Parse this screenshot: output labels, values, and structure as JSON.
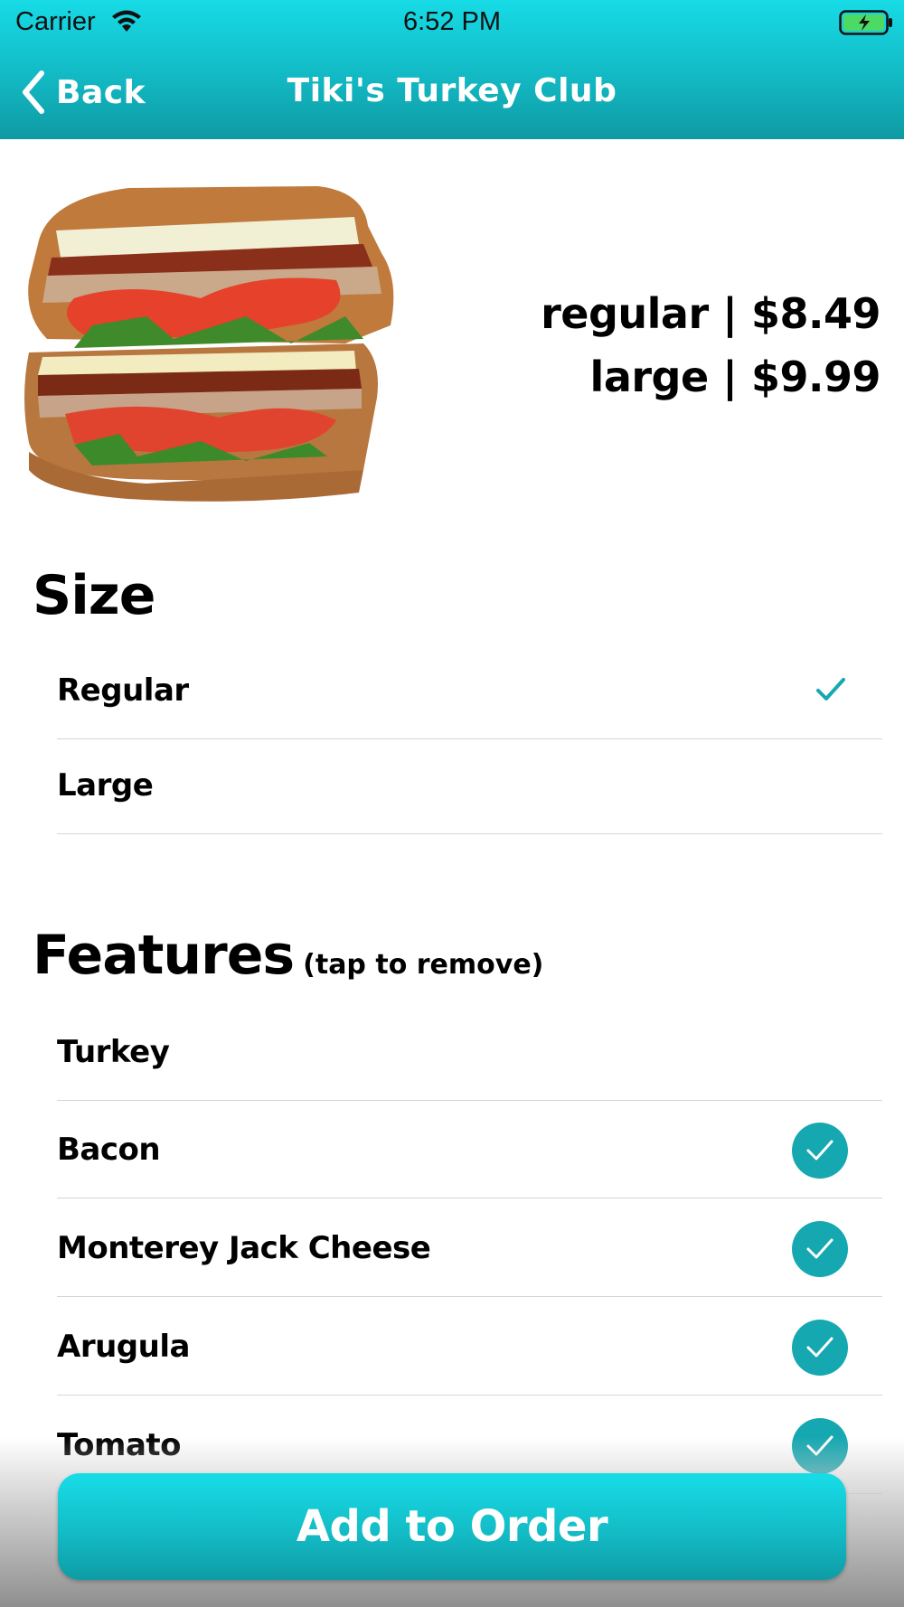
{
  "status_bar": {
    "carrier": "Carrier",
    "time": "6:52 PM",
    "wifi_icon": "wifi-icon",
    "battery_icon": "battery-charging-icon"
  },
  "nav": {
    "back_label": "Back",
    "title": "Tiki's Turkey Club"
  },
  "product": {
    "image_icon": "sandwich-image",
    "prices": [
      "regular | $8.49",
      "large | $9.99"
    ]
  },
  "size_section": {
    "title": "Size",
    "options": [
      {
        "label": "Regular",
        "selected": true
      },
      {
        "label": "Large",
        "selected": false
      }
    ]
  },
  "features_section": {
    "title": "Features",
    "note": "(tap to remove)",
    "items": [
      {
        "label": "Turkey",
        "checked": false
      },
      {
        "label": "Bacon",
        "checked": true
      },
      {
        "label": "Monterey Jack Cheese",
        "checked": true
      },
      {
        "label": "Arugula",
        "checked": true
      },
      {
        "label": "Tomato",
        "checked": true
      }
    ]
  },
  "footer": {
    "add_label": "Add to Order"
  },
  "colors": {
    "accent": "#16a8b1",
    "header_top": "#17dbe6",
    "header_bottom": "#0f9aa3"
  }
}
